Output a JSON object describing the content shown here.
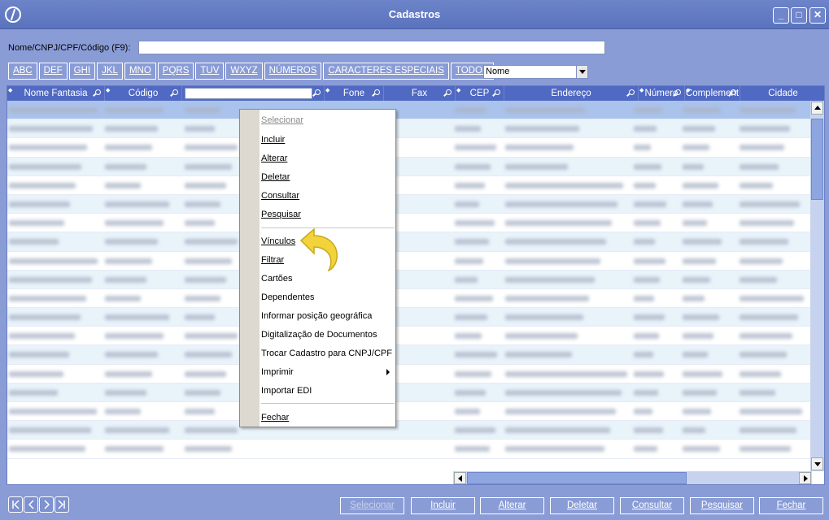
{
  "window": {
    "title": "Cadastros",
    "minimize": "_",
    "maximize": "□",
    "close": "✕"
  },
  "search": {
    "label": "Nome/CNPJ/CPF/Código (F9):",
    "value": ""
  },
  "letters": [
    "ABC",
    "DEF",
    "GHI",
    "JKL",
    "MNO",
    "PQRS",
    "TUV",
    "WXYZ",
    "NÚMEROS",
    "CARACTERES ESPECIAIS",
    "TODOS"
  ],
  "order_select": {
    "value": "Nome"
  },
  "grid": {
    "columns": [
      "Nome Fantasia",
      "Código",
      "",
      "Fone",
      "Fax",
      "CEP",
      "Endereço",
      "Número",
      "Complement",
      "Cidade"
    ],
    "row_count": 19
  },
  "context_menu": {
    "items": [
      {
        "label": "Selecionar",
        "disabled": true
      },
      {
        "label": "Incluir"
      },
      {
        "label": "Alterar"
      },
      {
        "label": "Deletar"
      },
      {
        "label": "Consultar"
      },
      {
        "label": "Pesquisar"
      },
      {
        "label": "Vínculos"
      },
      {
        "label": "Filtrar"
      },
      {
        "label": "Cartões"
      },
      {
        "label": "Dependentes"
      },
      {
        "label": "Informar posição geográfica"
      },
      {
        "label": "Digitalização de Documentos"
      },
      {
        "label": "Trocar Cadastro para CNPJ/CPF"
      },
      {
        "label": "Imprimir"
      },
      {
        "label": "Importar EDI"
      },
      {
        "label": "Fechar"
      }
    ]
  },
  "bottom_buttons": {
    "selecionar": "Selecionar",
    "incluir": "Incluir",
    "alterar": "Alterar",
    "deletar": "Deletar",
    "consultar": "Consultar",
    "pesquisar": "Pesquisar",
    "fechar": "Fechar"
  },
  "colors": {
    "background": "#8a9cd6",
    "header": "#5069c2",
    "selected_row": "#aac3ec",
    "alt_row": "#e9f3fa",
    "pointer_arrow": "#f2d33a"
  }
}
